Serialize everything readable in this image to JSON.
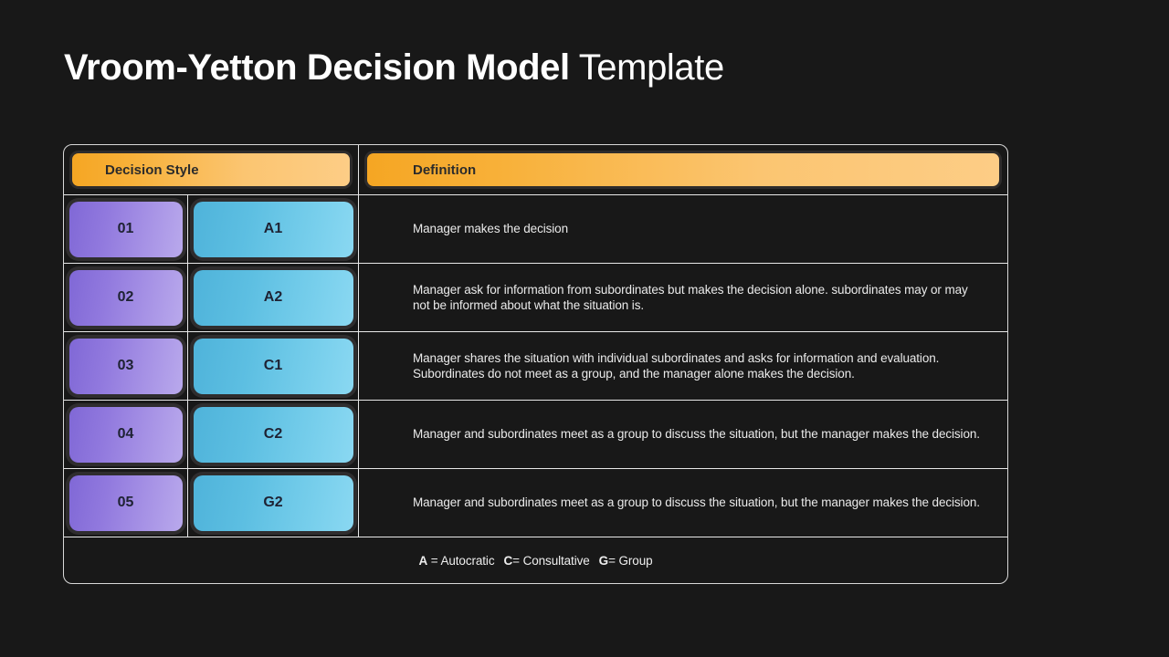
{
  "title": {
    "bold_part": "Vroom-Yetton Decision Model",
    "light_part": " Template"
  },
  "table": {
    "headers": {
      "decision_style": "Decision Style",
      "definition": "Definition"
    },
    "rows": [
      {
        "number": "01",
        "style": "A1",
        "definition": "Manager makes the decision"
      },
      {
        "number": "02",
        "style": "A2",
        "definition": "Manager ask for information from subordinates but makes the decision alone. subordinates may or may not be informed about what the situation is."
      },
      {
        "number": "03",
        "style": "C1",
        "definition": "Manager shares the situation with individual subordinates and asks for information and evaluation. Subordinates do not meet as a group, and the manager alone makes the decision."
      },
      {
        "number": "04",
        "style": "C2",
        "definition": "Manager and subordinates meet as a group to discuss  the situation, but the manager makes the decision."
      },
      {
        "number": "05",
        "style": "G2",
        "definition": "Manager and subordinates meet as a group to discuss  the situation, but the manager makes the decision."
      }
    ],
    "legend": {
      "a_key": "A",
      "a_value": " = Autocratic",
      "c_key": "C",
      "c_value": "= Consultative",
      "g_key": "G",
      "g_value": "= Group"
    }
  },
  "colors": {
    "background": "#181818",
    "header_pill_start": "#f5a623",
    "header_pill_end": "#fdcd86",
    "number_pill_start": "#8068d6",
    "number_pill_end": "#b9a9ec",
    "style_pill_start": "#4fb3da",
    "style_pill_end": "#8ad8f2",
    "table_border": "#d8d8d8",
    "text_primary": "#ffffff",
    "text_on_pill": "#1e2233"
  }
}
